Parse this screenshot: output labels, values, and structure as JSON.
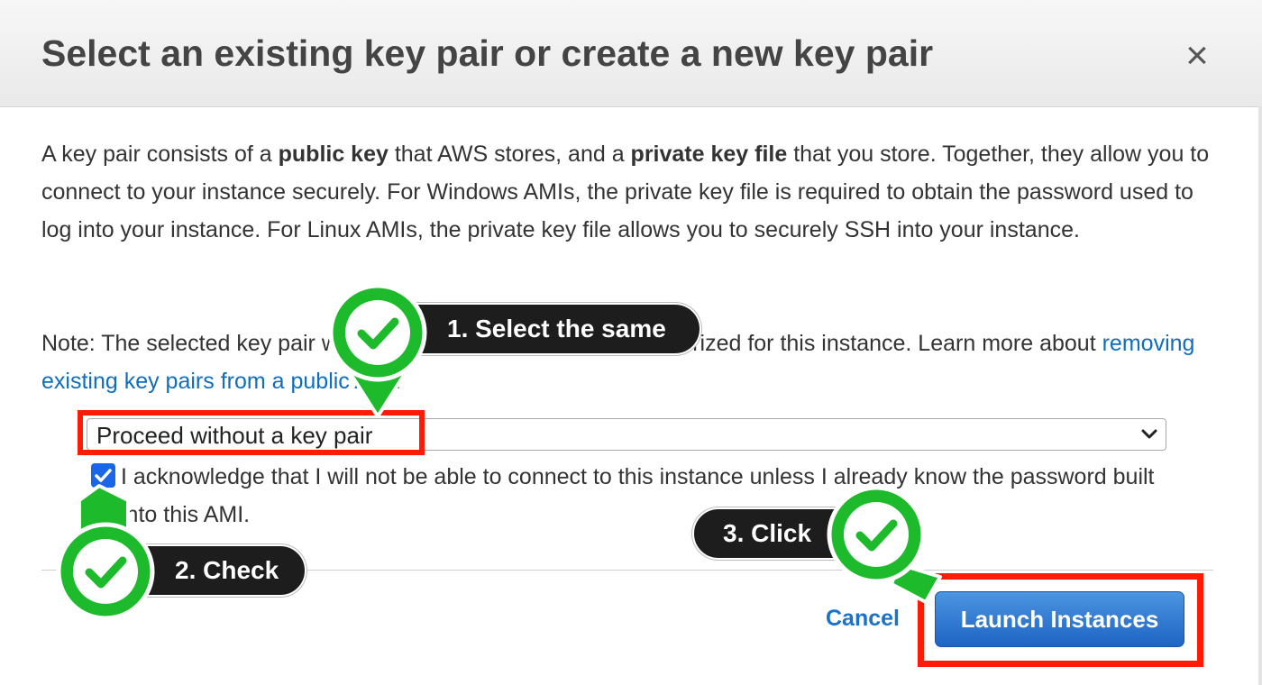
{
  "dialog": {
    "title": "Select an existing key pair or create a new key pair",
    "close_symbol": "×",
    "description": {
      "part1": "A key pair consists of a ",
      "bold1": "public key",
      "part2": " that AWS stores, and a ",
      "bold2": "private key file",
      "part3": " that you store. Together, they allow you to connect to your instance securely. For Windows AMIs, the private key file is required to obtain the password used to log into your instance. For Linux AMIs, the private key file allows you to securely SSH into your instance."
    },
    "note": {
      "text": "Note: The selected key pair will be added to the set of keys authorized for this instance. Learn more about ",
      "link": "removing existing key pairs from a public AMI",
      "end": "."
    },
    "key_pair_select": {
      "selected": "Proceed without a key pair"
    },
    "acknowledge": {
      "checked": true,
      "label": "I acknowledge that I will not be able to connect to this instance unless I already know the password built into this AMI."
    },
    "buttons": {
      "cancel": "Cancel",
      "launch": "Launch Instances"
    }
  },
  "annotations": [
    {
      "label": "1. Select the same"
    },
    {
      "label": "2. Check"
    },
    {
      "label": "3. Click"
    }
  ],
  "colors": {
    "highlight": "#ff1c06",
    "marker_green": "#1dbb2b",
    "link": "#0f6ebf",
    "primary_button": "#1d64c4",
    "callout_bg": "#1d1d1d"
  },
  "icons": [
    "close-icon",
    "chevron-down-icon",
    "checkbox-checked-icon",
    "checkmark-marker-icon"
  ]
}
